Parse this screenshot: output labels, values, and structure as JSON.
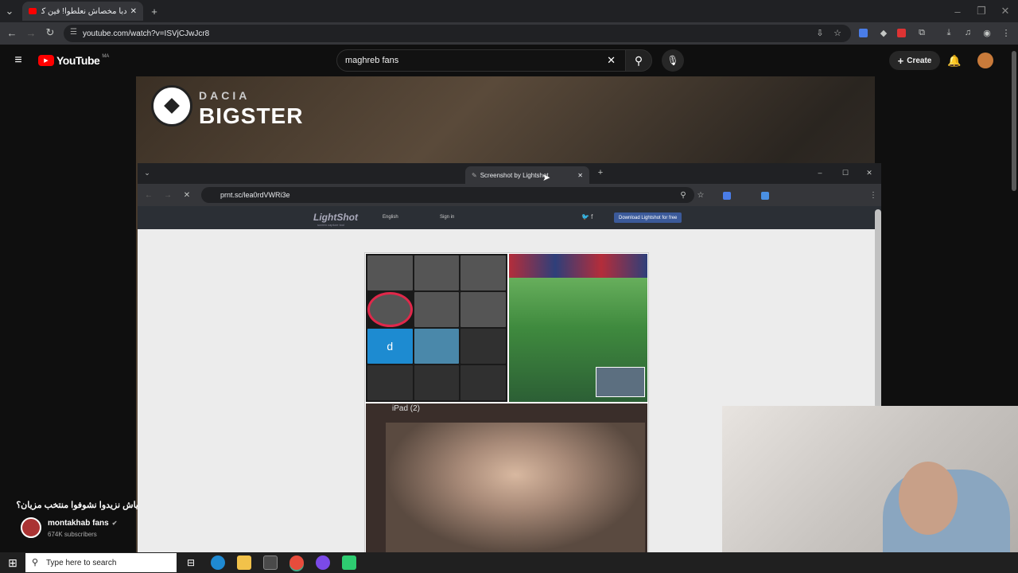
{
  "browser": {
    "tab_title": "دبا مخصاش نعلطوا! فين كان الـ",
    "url": "youtube.com/watch?v=ISVjCJwJcr8"
  },
  "youtube": {
    "logo_text": "YouTube",
    "region": "MA",
    "search_value": "maghreb fans",
    "create_label": "Create"
  },
  "video": {
    "brand_line1": "DACIA",
    "brand_line2": "BIGSTER",
    "title": "ياش نزيدوا نشوفوا منتخب مزيان؟",
    "channel": "montakhab fans",
    "subscribers": "674K subscribers"
  },
  "inner_browser": {
    "tab_title": "Screenshot by Lightshot",
    "url": "prnt.sc/lea0rdVWRi3e",
    "site_logo": "LightShot",
    "site_tagline": "screen capture tool",
    "lang": "English",
    "signin": "Sign in",
    "download": "Download Lightshot for free",
    "ipad_label": "iPad (2)",
    "grid_letter": "d"
  },
  "taskbar": {
    "search_placeholder": "Type here to search"
  },
  "colors": {
    "yt_red": "#ff0000",
    "bg": "#0f0f0f",
    "circle": "#e0284a"
  }
}
